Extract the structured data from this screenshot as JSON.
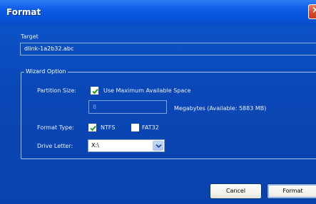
{
  "window": {
    "title": "Format"
  },
  "target": {
    "label": "Target",
    "value": "dlink-1a2b32.abc"
  },
  "wizard": {
    "legend": "Wizard Option",
    "partition_size_label": "Partition Size:",
    "use_max_label": "Use Maximum Available Space",
    "use_max_checked": true,
    "size_value": "8",
    "megabytes_label": "Megabytes (Available: 5883 MB)",
    "format_type_label": "Format Type:",
    "ntfs_label": "NTFS",
    "ntfs_checked": true,
    "fat32_label": "FAT32",
    "fat32_checked": false,
    "drive_letter_label": "Drive Letter:",
    "drive_letter_value": "X:\\"
  },
  "buttons": {
    "cancel": "Cancel",
    "format": "Format"
  },
  "icons": {
    "close": "close-icon",
    "check": "check-icon",
    "dropdown": "chevron-down-icon"
  },
  "colors": {
    "titlebar": "#0d5de6",
    "dialog_bg": "#0a4cc0",
    "close": "#d84a2a"
  }
}
